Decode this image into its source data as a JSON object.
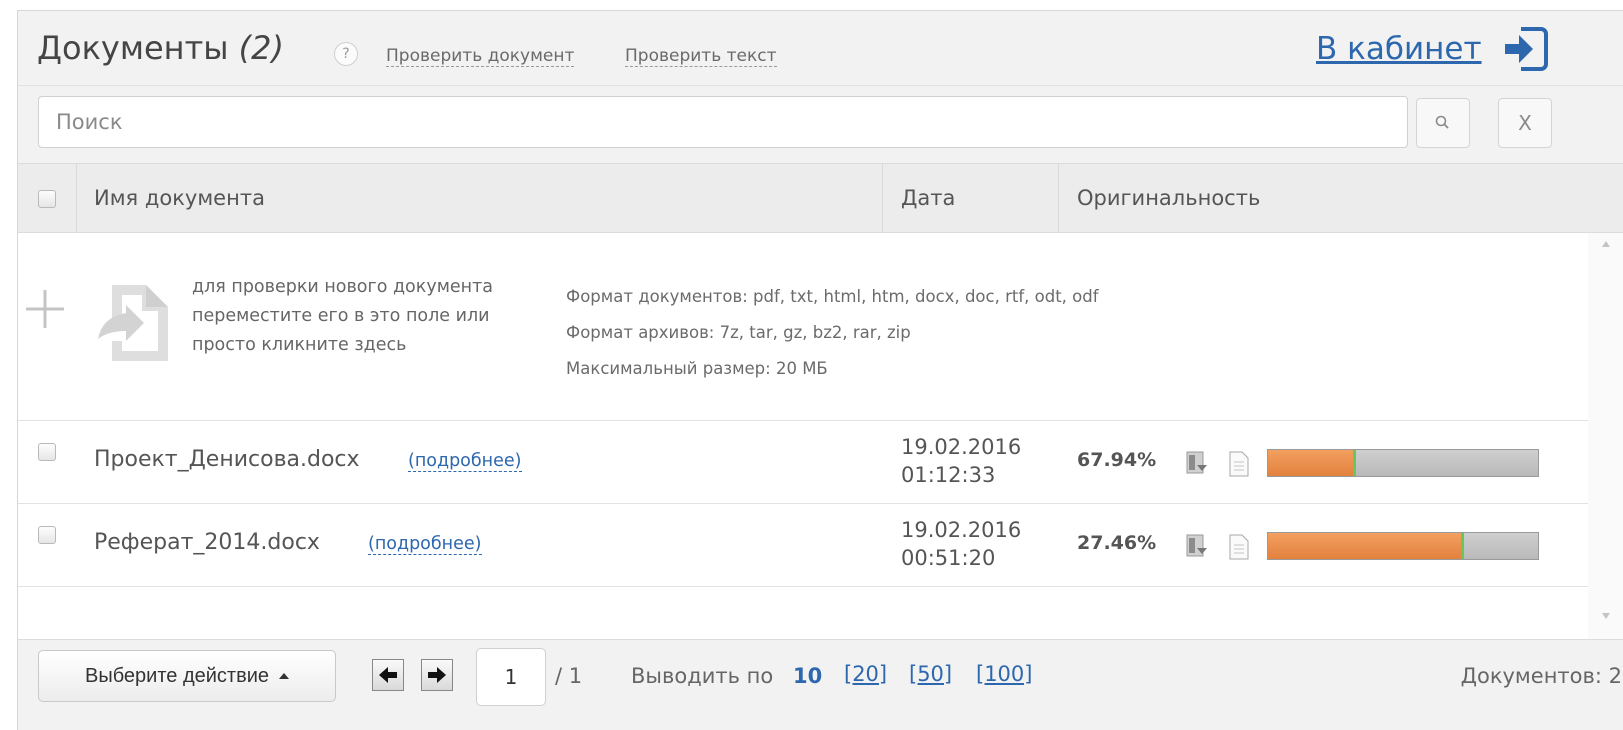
{
  "header": {
    "title": "Документы",
    "count": "(2)",
    "help": "?",
    "check_document": "Проверить документ",
    "check_text": "Проверить текст",
    "cabinet": "В кабинет"
  },
  "search": {
    "placeholder": "Поиск",
    "clear_label": "X"
  },
  "columns": {
    "name": "Имя документа",
    "date": "Дата",
    "originality": "Оригинальность"
  },
  "upload": {
    "hint": "для проверки нового документа переместите его в это поле или просто кликните здесь",
    "formats_documents": "Формат документов: pdf, txt, html, htm, docx, doc, rtf, odt, odf",
    "formats_archives": "Формат архивов: 7z, tar, gz, bz2, rar, zip",
    "max_size": "Максимальный размер: 20 МБ"
  },
  "documents": [
    {
      "name": "Проект_Денисова.docx",
      "more": "(подробнее)",
      "date": "19.02.2016",
      "time": "01:12:33",
      "originality": "67.94%",
      "originality_value": 67.94,
      "borrowed_fraction": 0.32
    },
    {
      "name": "Реферат_2014.docx",
      "more": "(подробнее)",
      "date": "19.02.2016",
      "time": "00:51:20",
      "originality": "27.46%",
      "originality_value": 27.46,
      "borrowed_fraction": 0.72
    }
  ],
  "footer": {
    "action": "Выберите действие",
    "page_current": "1",
    "page_total": "/ 1",
    "per_page_label": "Выводить по",
    "per_page_current": "10",
    "per_page_options": [
      "[20]",
      "[50]",
      "[100]"
    ],
    "doc_count": "Документов: 2"
  },
  "colors": {
    "accent": "#2d67ad",
    "bar_borrowed": "#e8883f",
    "bar_original": "#c2c2c2",
    "bar_marker": "#66c85a"
  },
  "icons": [
    "help-icon",
    "login-icon",
    "search-icon",
    "plus-icon",
    "document-import-icon",
    "report-icon",
    "page-icon",
    "arrow-left-icon",
    "arrow-right-icon"
  ]
}
